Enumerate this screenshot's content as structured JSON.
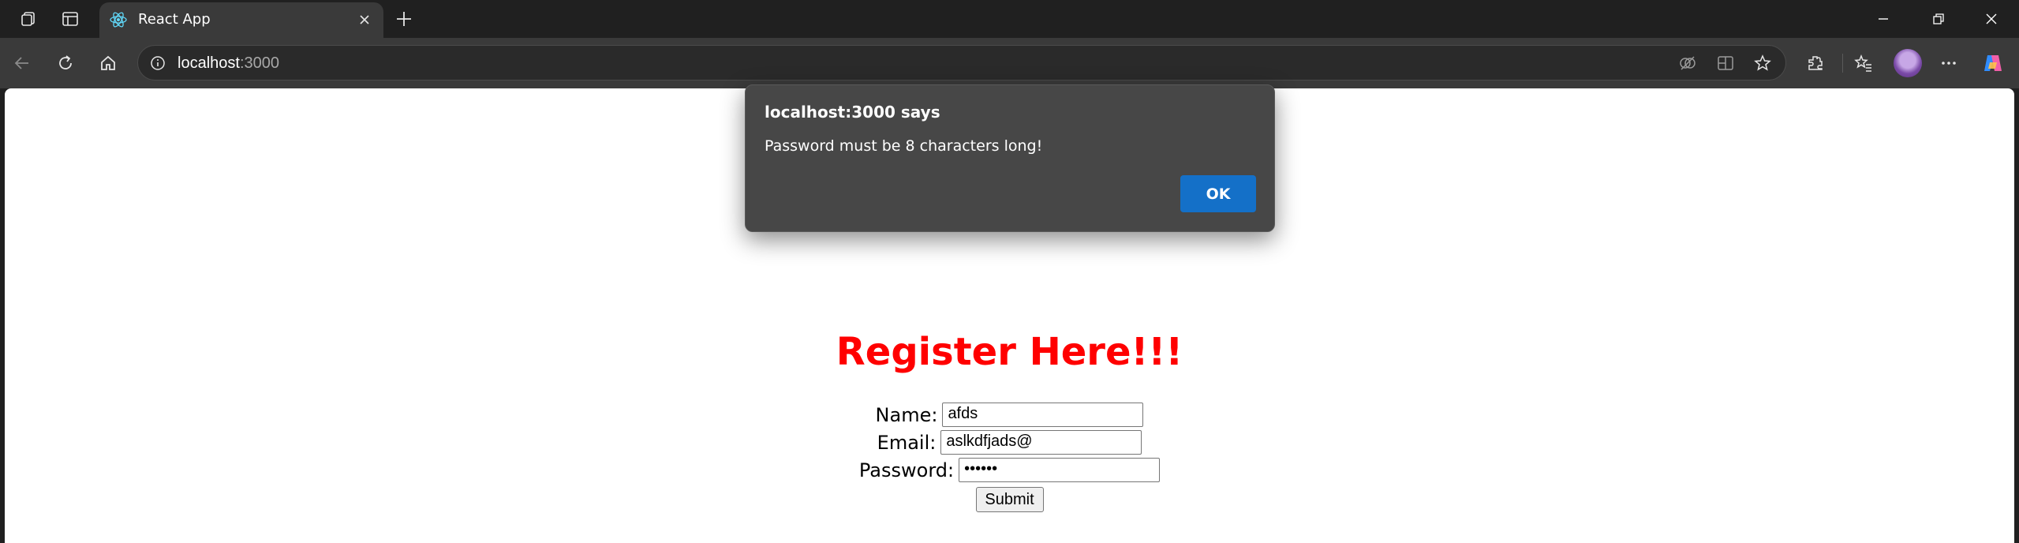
{
  "browser": {
    "tab_title": "React App",
    "address": {
      "host": "localhost",
      "port": ":3000"
    }
  },
  "page": {
    "heading": "Register Here!!!",
    "form": {
      "name_label": "Name:",
      "name_value": "afds",
      "email_label": "Email:",
      "email_value": "aslkdfjads@",
      "password_label": "Password:",
      "password_value": "••••••",
      "submit_label": "Submit"
    }
  },
  "dialog": {
    "title": "localhost:3000 says",
    "message": "Password must be 8 characters long!",
    "ok_label": "OK"
  },
  "colors": {
    "heading": "#ff0000",
    "dialog_bg": "#474747",
    "ok_button": "#1470c8",
    "toolbar": "#3a3a3a",
    "titlebar": "#202020"
  },
  "icons": [
    "workspaces-icon",
    "tab-actions-icon",
    "react-icon",
    "close-icon",
    "plus-icon",
    "minimize-icon",
    "restore-icon",
    "window-close-icon",
    "back-icon",
    "refresh-icon",
    "home-icon",
    "info-icon",
    "read-aloud-icon",
    "split-screen-icon",
    "favorite-star-icon",
    "extensions-icon",
    "favorites-icon",
    "profile-avatar",
    "more-icon",
    "copilot-icon"
  ]
}
